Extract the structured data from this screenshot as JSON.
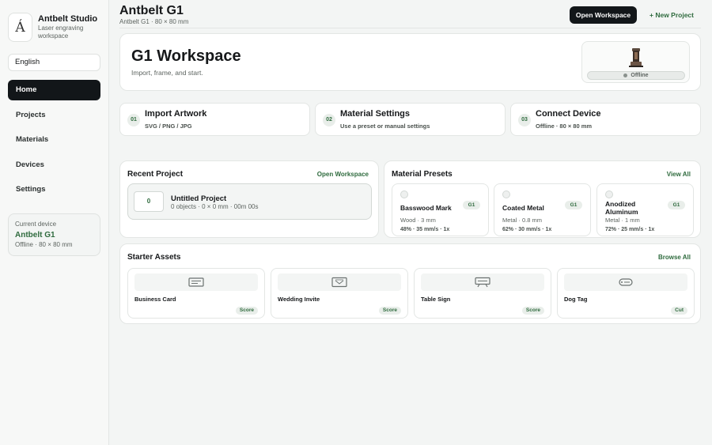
{
  "sidebar": {
    "logo_glyph": "Á",
    "brand_name": "Antbelt Studio",
    "brand_sub": "Laser engraving workspace",
    "language": "English",
    "nav": [
      {
        "label": "Home",
        "active": true
      },
      {
        "label": "Projects"
      },
      {
        "label": "Materials"
      },
      {
        "label": "Devices"
      },
      {
        "label": "Settings"
      }
    ],
    "device_card": {
      "label": "Current device",
      "name": "Antbelt G1",
      "meta": "Offline · 80 × 80 mm"
    }
  },
  "header": {
    "title": "Antbelt G1",
    "subtitle": "Antbelt G1 · 80 × 80 mm",
    "open_workspace": "Open Workspace",
    "new_project": "+ New Project"
  },
  "hero": {
    "title": "G1 Workspace",
    "subtitle": "Import, frame, and start.",
    "device_status": "Offline"
  },
  "steps": [
    {
      "num": "01",
      "title": "Import Artwork",
      "sub": "SVG / PNG / JPG"
    },
    {
      "num": "02",
      "title": "Material Settings",
      "sub": "Use a preset or manual settings"
    },
    {
      "num": "03",
      "title": "Connect Device",
      "sub": "Offline · 80 × 80 mm"
    }
  ],
  "recent": {
    "title": "Recent Project",
    "link": "Open Workspace",
    "project": {
      "thumb": "0",
      "name": "Untitled Project",
      "meta": "0 objects · 0 × 0 mm · 00m 00s"
    }
  },
  "presets": {
    "title": "Material Presets",
    "link": "View All",
    "items": [
      {
        "name": "Basswood Mark",
        "badge": "G1",
        "material": "Wood · 3 mm",
        "settings": "48% · 35 mm/s · 1x"
      },
      {
        "name": "Coated Metal",
        "badge": "G1",
        "material": "Metal · 0.8 mm",
        "settings": "62% · 30 mm/s · 1x"
      },
      {
        "name": "Anodized Aluminum",
        "badge": "G1",
        "material": "Metal · 1 mm",
        "settings": "72% · 25 mm/s · 1x"
      }
    ]
  },
  "assets": {
    "title": "Starter Assets",
    "link": "Browse All",
    "items": [
      {
        "name": "Business Card",
        "badge": "Score",
        "icon": "business-card-icon"
      },
      {
        "name": "Wedding Invite",
        "badge": "Score",
        "icon": "invite-icon"
      },
      {
        "name": "Table Sign",
        "badge": "Score",
        "icon": "table-sign-icon"
      },
      {
        "name": "Dog Tag",
        "badge": "Cut",
        "icon": "dog-tag-icon"
      }
    ]
  },
  "colors": {
    "accent_green": "#2f6b3e",
    "dark": "#121619",
    "background": "#f3f5f4"
  }
}
